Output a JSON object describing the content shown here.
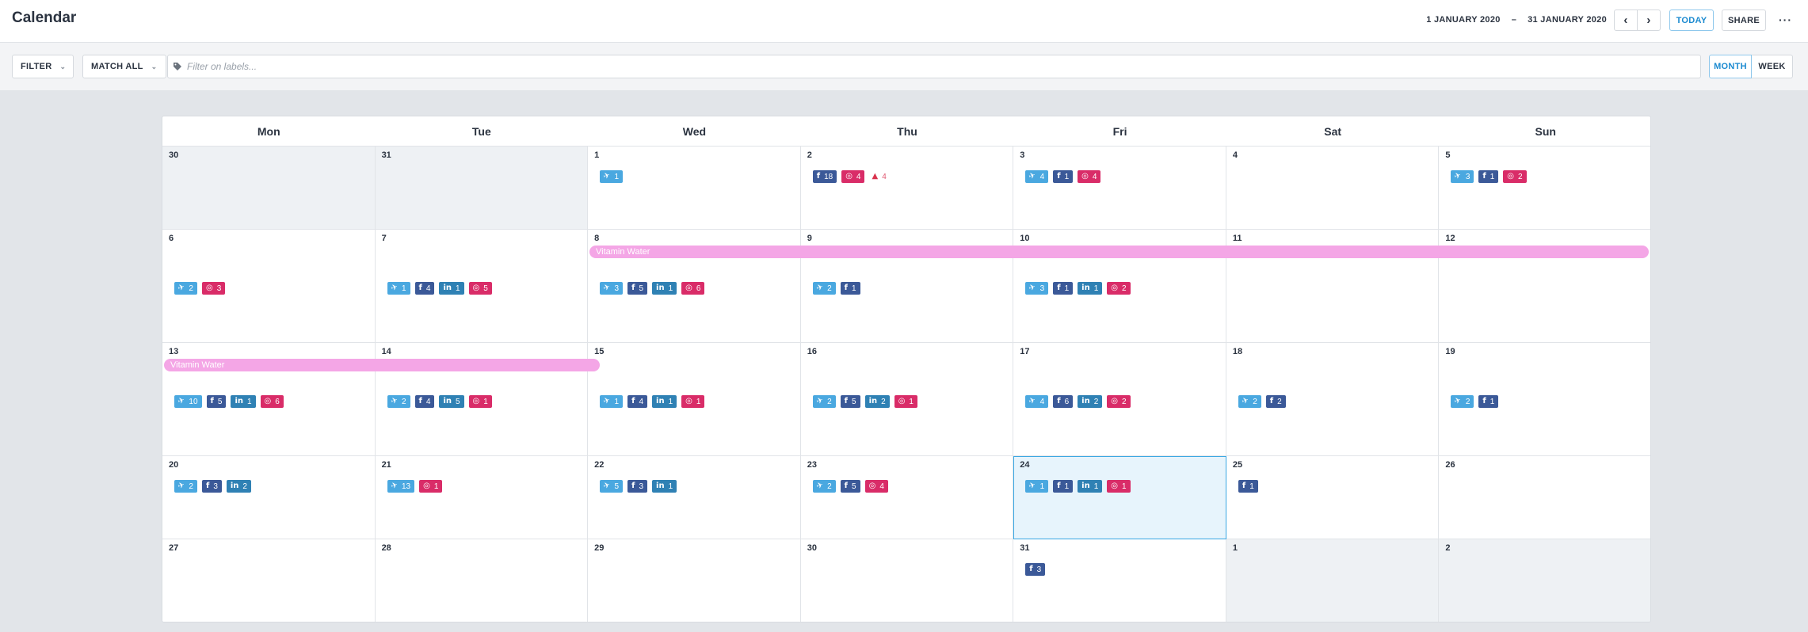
{
  "header": {
    "title": "Calendar",
    "date_start": "1 JANUARY 2020",
    "date_sep": "–",
    "date_end": "31 JANUARY 2020",
    "today_label": "TODAY",
    "share_label": "SHARE",
    "more_label": "···",
    "prev_icon": "‹",
    "next_icon": "›"
  },
  "filterbar": {
    "filter_label": "FILTER",
    "match_label": "MATCH ALL",
    "label_placeholder": "Filter on labels...",
    "view_month": "MONTH",
    "view_week": "WEEK",
    "active_view": "MONTH"
  },
  "colors": {
    "twitter": "#4aa8e0",
    "facebook": "#3b5998",
    "linkedin": "#2f81b4",
    "instagram": "#d92c68",
    "event": "#f4a6e6",
    "accent": "#1b8ad0"
  },
  "icons": {
    "twitter": "twitter-icon",
    "facebook": "facebook-icon",
    "linkedin": "linkedin-icon",
    "instagram": "instagram-icon",
    "alert": "warning-icon"
  },
  "days_of_week": [
    "Mon",
    "Tue",
    "Wed",
    "Thu",
    "Fri",
    "Sat",
    "Sun"
  ],
  "weeks": [
    [
      {
        "day": "30",
        "other": true,
        "chips": []
      },
      {
        "day": "31",
        "other": true,
        "chips": []
      },
      {
        "day": "1",
        "chips": [
          {
            "type": "twitter",
            "count": "1"
          }
        ]
      },
      {
        "day": "2",
        "chips": [
          {
            "type": "facebook",
            "count": "18"
          },
          {
            "type": "instagram",
            "count": "4"
          },
          {
            "type": "alert",
            "count": "4"
          }
        ]
      },
      {
        "day": "3",
        "chips": [
          {
            "type": "twitter",
            "count": "4"
          },
          {
            "type": "facebook",
            "count": "1"
          },
          {
            "type": "instagram",
            "count": "4"
          }
        ]
      },
      {
        "day": "4",
        "chips": []
      },
      {
        "day": "5",
        "chips": [
          {
            "type": "twitter",
            "count": "3"
          },
          {
            "type": "facebook",
            "count": "1"
          },
          {
            "type": "instagram",
            "count": "2"
          }
        ]
      }
    ],
    [
      {
        "day": "6",
        "chips": [
          {
            "type": "twitter",
            "count": "2"
          },
          {
            "type": "instagram",
            "count": "3"
          }
        ]
      },
      {
        "day": "7",
        "chips": [
          {
            "type": "twitter",
            "count": "1"
          },
          {
            "type": "facebook",
            "count": "4"
          },
          {
            "type": "linkedin",
            "count": "1"
          },
          {
            "type": "instagram",
            "count": "5"
          }
        ]
      },
      {
        "day": "8",
        "chips": [
          {
            "type": "twitter",
            "count": "3"
          },
          {
            "type": "facebook",
            "count": "5"
          },
          {
            "type": "linkedin",
            "count": "1"
          },
          {
            "type": "instagram",
            "count": "6"
          }
        ]
      },
      {
        "day": "9",
        "chips": [
          {
            "type": "twitter",
            "count": "2"
          },
          {
            "type": "facebook",
            "count": "1"
          }
        ]
      },
      {
        "day": "10",
        "chips": [
          {
            "type": "twitter",
            "count": "3"
          },
          {
            "type": "facebook",
            "count": "1"
          },
          {
            "type": "linkedin",
            "count": "1"
          },
          {
            "type": "instagram",
            "count": "2"
          }
        ]
      },
      {
        "day": "11",
        "chips": []
      },
      {
        "day": "12",
        "chips": []
      }
    ],
    [
      {
        "day": "13",
        "chips": [
          {
            "type": "twitter",
            "count": "10"
          },
          {
            "type": "facebook",
            "count": "5"
          },
          {
            "type": "linkedin",
            "count": "1"
          },
          {
            "type": "instagram",
            "count": "6"
          }
        ]
      },
      {
        "day": "14",
        "chips": [
          {
            "type": "twitter",
            "count": "2"
          },
          {
            "type": "facebook",
            "count": "4"
          },
          {
            "type": "linkedin",
            "count": "5"
          },
          {
            "type": "instagram",
            "count": "1"
          }
        ]
      },
      {
        "day": "15",
        "chips": [
          {
            "type": "twitter",
            "count": "1"
          },
          {
            "type": "facebook",
            "count": "4"
          },
          {
            "type": "linkedin",
            "count": "1"
          },
          {
            "type": "instagram",
            "count": "1"
          }
        ]
      },
      {
        "day": "16",
        "chips": [
          {
            "type": "twitter",
            "count": "2"
          },
          {
            "type": "facebook",
            "count": "5"
          },
          {
            "type": "linkedin",
            "count": "2"
          },
          {
            "type": "instagram",
            "count": "1"
          }
        ]
      },
      {
        "day": "17",
        "chips": [
          {
            "type": "twitter",
            "count": "4"
          },
          {
            "type": "facebook",
            "count": "6"
          },
          {
            "type": "linkedin",
            "count": "2"
          },
          {
            "type": "instagram",
            "count": "2"
          }
        ]
      },
      {
        "day": "18",
        "chips": [
          {
            "type": "twitter",
            "count": "2"
          },
          {
            "type": "facebook",
            "count": "2"
          }
        ]
      },
      {
        "day": "19",
        "chips": [
          {
            "type": "twitter",
            "count": "2"
          },
          {
            "type": "facebook",
            "count": "1"
          }
        ]
      }
    ],
    [
      {
        "day": "20",
        "chips": [
          {
            "type": "twitter",
            "count": "2"
          },
          {
            "type": "facebook",
            "count": "3"
          },
          {
            "type": "linkedin",
            "count": "2"
          }
        ]
      },
      {
        "day": "21",
        "chips": [
          {
            "type": "twitter",
            "count": "13"
          },
          {
            "type": "instagram",
            "count": "1"
          }
        ]
      },
      {
        "day": "22",
        "chips": [
          {
            "type": "twitter",
            "count": "5"
          },
          {
            "type": "facebook",
            "count": "3"
          },
          {
            "type": "linkedin",
            "count": "1"
          }
        ]
      },
      {
        "day": "23",
        "chips": [
          {
            "type": "twitter",
            "count": "2"
          },
          {
            "type": "facebook",
            "count": "5"
          },
          {
            "type": "instagram",
            "count": "4"
          }
        ]
      },
      {
        "day": "24",
        "today": true,
        "chips": [
          {
            "type": "twitter",
            "count": "1"
          },
          {
            "type": "facebook",
            "count": "1"
          },
          {
            "type": "linkedin",
            "count": "1"
          },
          {
            "type": "instagram",
            "count": "1"
          }
        ]
      },
      {
        "day": "25",
        "chips": [
          {
            "type": "facebook",
            "count": "1"
          }
        ]
      },
      {
        "day": "26",
        "chips": []
      }
    ],
    [
      {
        "day": "27",
        "chips": []
      },
      {
        "day": "28",
        "chips": []
      },
      {
        "day": "29",
        "chips": []
      },
      {
        "day": "30",
        "chips": []
      },
      {
        "day": "31",
        "chips": [
          {
            "type": "facebook",
            "count": "3"
          }
        ]
      },
      {
        "day": "1",
        "other": true,
        "chips": []
      },
      {
        "day": "2",
        "other": true,
        "chips": []
      }
    ]
  ],
  "events": [
    {
      "label": "Vitamin Water",
      "start": "8",
      "end": "12"
    },
    {
      "label": "Vitamin Water",
      "start": "13",
      "end": "15"
    }
  ]
}
